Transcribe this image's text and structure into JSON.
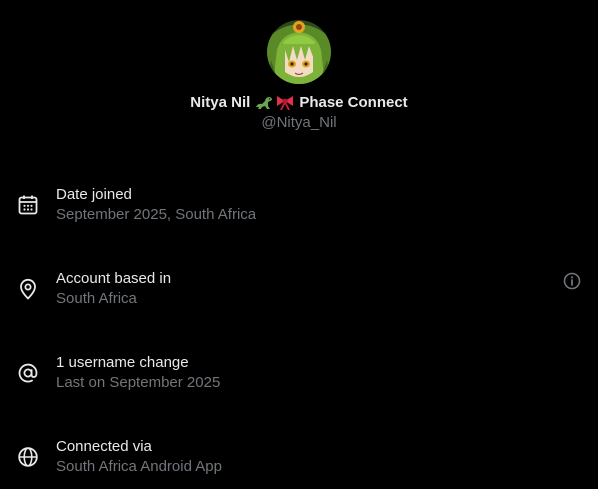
{
  "profile": {
    "display_name": "Nitya Nil",
    "affiliation": "Phase Connect",
    "handle": "@Nitya_Nil",
    "emojis": [
      "dinosaur-emoji",
      "ribbon-emoji"
    ]
  },
  "rows": [
    {
      "title": "Date joined",
      "subtitle": "September 2025, South Africa",
      "icon": "calendar-icon"
    },
    {
      "title": "Account based in",
      "subtitle": "South Africa",
      "icon": "location-pin-icon",
      "trailing_icon": "info-icon"
    },
    {
      "title": "1 username change",
      "subtitle": "Last on September 2025",
      "icon": "at-sign-icon"
    },
    {
      "title": "Connected via",
      "subtitle": "South Africa Android App",
      "icon": "globe-icon"
    }
  ],
  "colors": {
    "background": "#000000",
    "primary_text": "#e7e9ea",
    "secondary_text": "#71767b"
  }
}
